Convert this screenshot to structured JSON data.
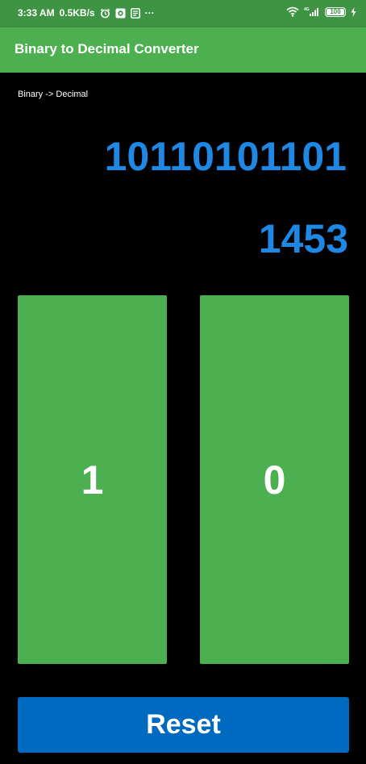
{
  "status_bar": {
    "time": "3:33 AM",
    "net_speed": "0.5KB/s",
    "more": "···",
    "network": "4G",
    "battery": "100",
    "icons": [
      "alarm-icon",
      "app-icon",
      "notes-icon",
      "wifi-icon",
      "signal-icon",
      "battery-icon",
      "charging-icon"
    ]
  },
  "app_bar": {
    "title": "Binary to Decimal Converter",
    "color": "#4caf50"
  },
  "converter": {
    "mode": "Binary -> Decimal",
    "binary_value": "10110101101",
    "decimal_value": "1453",
    "display_color": "#1e88e5"
  },
  "buttons": {
    "one_label": "1",
    "zero_label": "0",
    "reset_label": "Reset",
    "bit_color": "#4caf50",
    "reset_color": "#0069c0"
  }
}
